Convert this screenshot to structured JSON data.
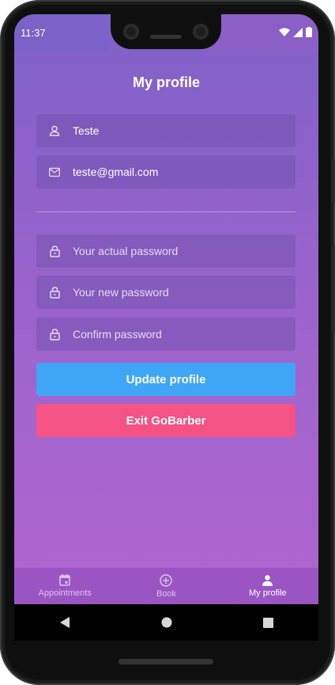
{
  "status": {
    "time": "11:37"
  },
  "header": {
    "title": "My profile"
  },
  "profile": {
    "name": {
      "value": "Teste",
      "icon": "user-icon"
    },
    "email": {
      "value": "teste@gmail.com",
      "icon": "mail-icon"
    }
  },
  "password": {
    "current_placeholder": "Your actual password",
    "new_placeholder": "Your new password",
    "confirm_placeholder": "Confirm password"
  },
  "buttons": {
    "update": "Update profile",
    "exit": "Exit GoBarber"
  },
  "tabs": [
    {
      "label": "Appointments",
      "icon": "calendar-icon",
      "active": false
    },
    {
      "label": "Book",
      "icon": "plus-circle-icon",
      "active": false
    },
    {
      "label": "My profile",
      "icon": "person-icon",
      "active": true
    }
  ],
  "colors": {
    "background_top": "#7e61c7",
    "background_bottom": "#b065cf",
    "update_button": "#3fa6f6",
    "exit_button": "#f55285",
    "tab_bar": "#9a55c3"
  }
}
